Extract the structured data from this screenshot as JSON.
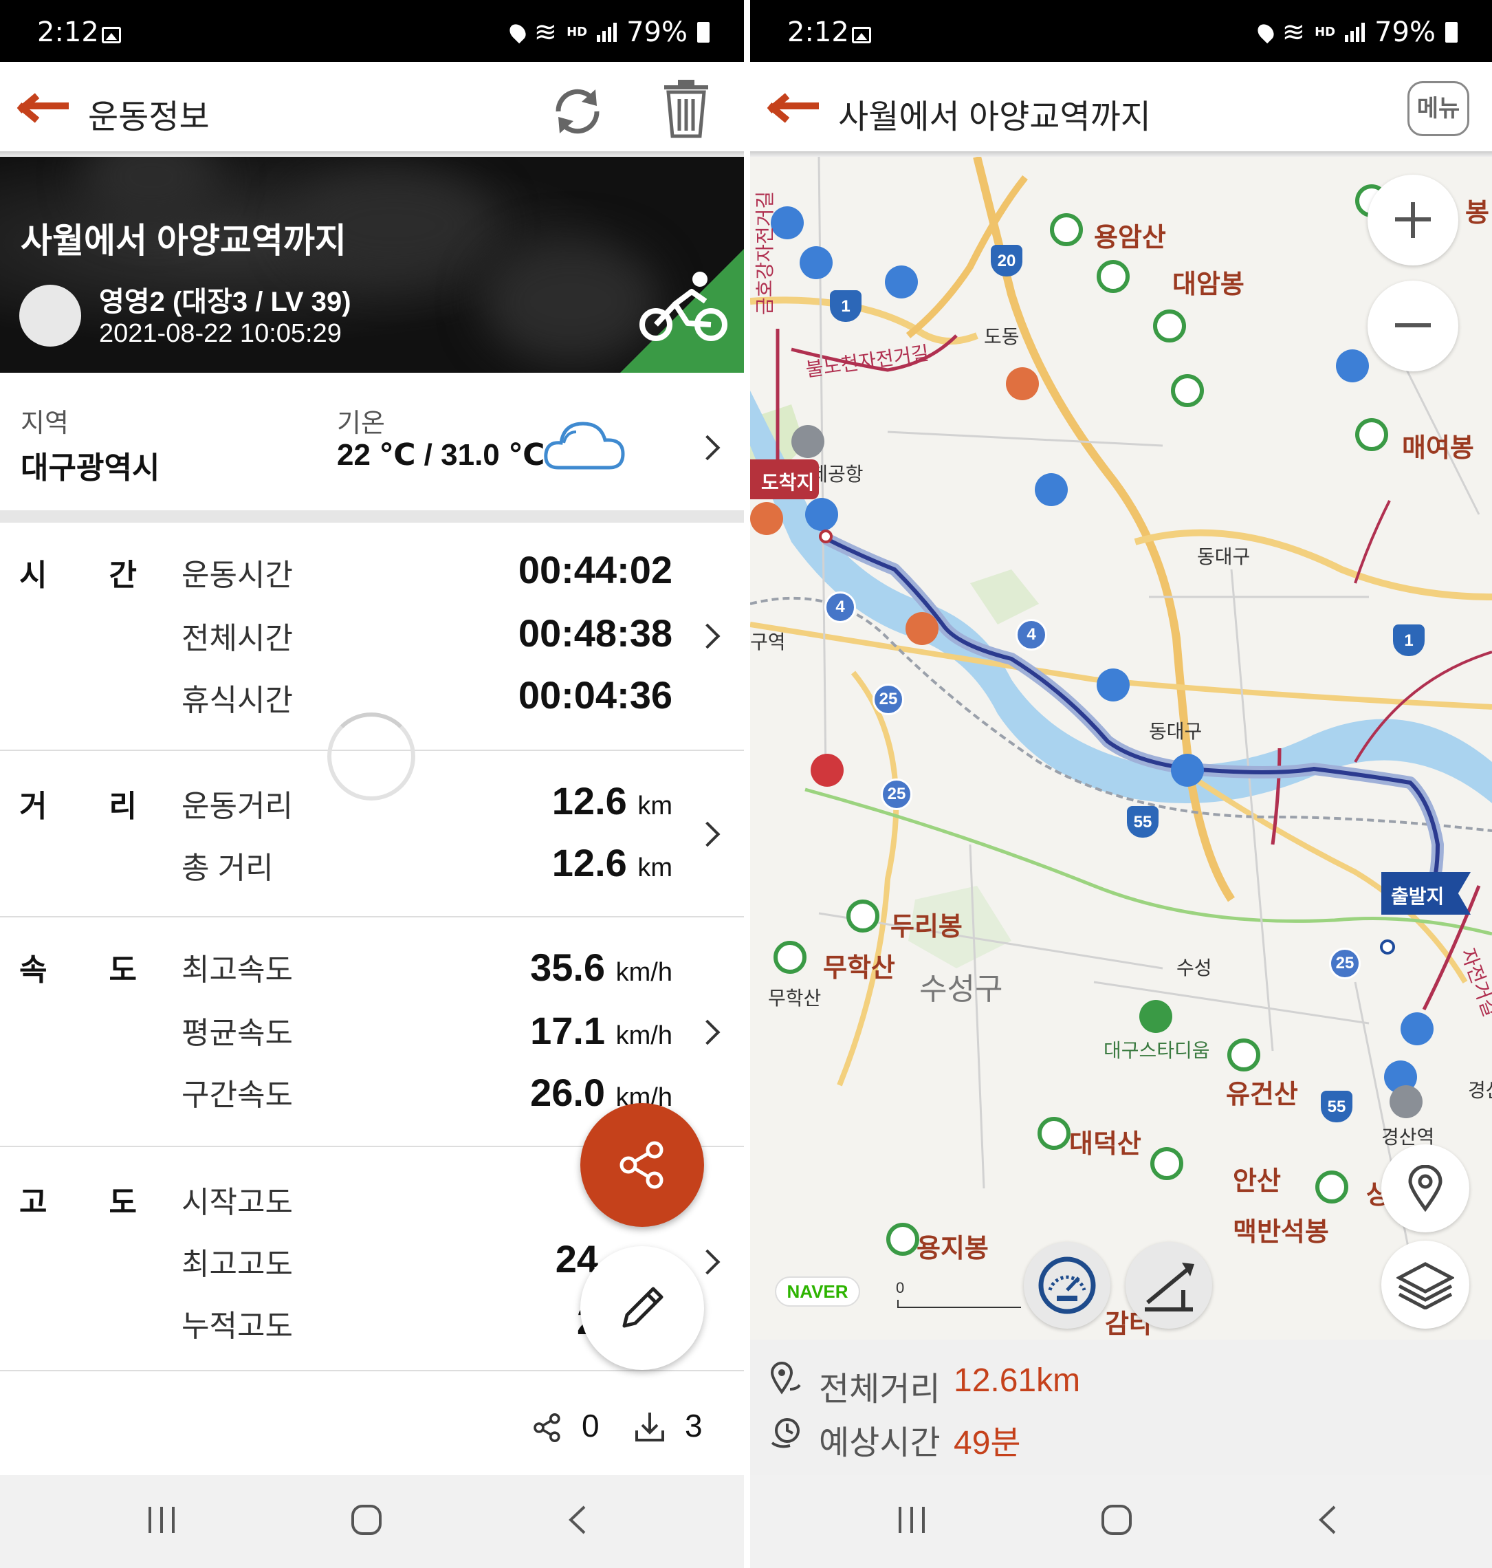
{
  "status": {
    "time": "2:12",
    "hd": "HD",
    "voice": "voice",
    "battery": "79%"
  },
  "left": {
    "title": "운동정보",
    "hero": {
      "title": "사월에서 아양교역까지",
      "user": "영영2 (대장3 / LV 39)",
      "datetime": "2021-08-22 10:05:29"
    },
    "region_label": "지역",
    "region_value": "대구광역시",
    "temp_label": "기온",
    "temp_value": "22 ℃ / 31.0 ℃",
    "sections": {
      "time": {
        "cat": "시간",
        "rows": [
          {
            "name": "운동시간",
            "value": "00:44:02"
          },
          {
            "name": "전체시간",
            "value": "00:48:38"
          },
          {
            "name": "휴식시간",
            "value": "00:04:36"
          }
        ]
      },
      "distance": {
        "cat": "거리",
        "rows": [
          {
            "name": "운동거리",
            "value": "12.6",
            "unit": "km"
          },
          {
            "name": "총 거리",
            "value": "12.6",
            "unit": "km"
          }
        ]
      },
      "speed": {
        "cat": "속도",
        "rows": [
          {
            "name": "최고속도",
            "value": "35.6",
            "unit": "km/h"
          },
          {
            "name": "평균속도",
            "value": "17.1",
            "unit": "km/h"
          },
          {
            "name": "구간속도",
            "value": "26.0",
            "unit": "km/h"
          }
        ]
      },
      "altitude": {
        "cat": "고도",
        "rows": [
          {
            "name": "시작고도",
            "value": ""
          },
          {
            "name": "최고고도",
            "value": "24"
          },
          {
            "name": "누적고도",
            "value": "2"
          }
        ]
      }
    },
    "share_count": "0",
    "download_count": "3"
  },
  "right": {
    "title": "사월에서 아양교역까지",
    "menu": "메뉴",
    "total_distance_label": "전체거리",
    "total_distance": "12.61km",
    "eta_label": "예상시간",
    "eta": "49분",
    "map": {
      "arrival": "도착지",
      "departure": "출발지",
      "naver": "NAVER",
      "scale": "0",
      "places": [
        "용암산",
        "대암봉",
        "매여봉",
        "두리봉",
        "무학산",
        "수성구",
        "유건산",
        "대덕산",
        "안산",
        "용지봉",
        "맥반석봉",
        "봉",
        "상",
        "경산",
        "감타"
      ],
      "small_places": [
        "도동",
        "동대구",
        "동대구",
        "수성",
        "대구스타디움",
        "무학산",
        "대구국제공항",
        "구역",
        "경산역"
      ],
      "roads": [
        "불노천자전거길",
        "금호강자전거길",
        "자전거길"
      ],
      "shields": [
        "20",
        "1",
        "1",
        "4",
        "4",
        "25",
        "25",
        "55",
        "55",
        "25",
        "25"
      ]
    }
  },
  "colors": {
    "accent": "#c5411b",
    "green": "#3a9a45",
    "route": "#2b3a8f",
    "river": "#aad3ef"
  }
}
